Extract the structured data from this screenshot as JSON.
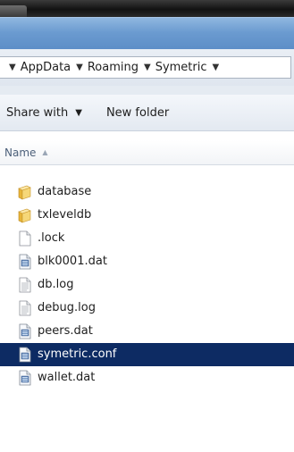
{
  "breadcrumb": {
    "items": [
      {
        "label": "AppData"
      },
      {
        "label": "Roaming"
      },
      {
        "label": "Symetric"
      },
      {
        "label": ""
      }
    ]
  },
  "toolbar": {
    "share_label": "Share with",
    "new_folder_label": "New folder"
  },
  "columns": {
    "name_label": "Name"
  },
  "files": [
    {
      "name": "database",
      "type": "folder-icon",
      "selected": false
    },
    {
      "name": "txleveldb",
      "type": "folder-icon",
      "selected": false
    },
    {
      "name": ".lock",
      "type": "blank-file-icon",
      "selected": false
    },
    {
      "name": "blk0001.dat",
      "type": "dat-file-icon",
      "selected": false
    },
    {
      "name": "db.log",
      "type": "text-file-icon",
      "selected": false
    },
    {
      "name": "debug.log",
      "type": "text-file-icon",
      "selected": false
    },
    {
      "name": "peers.dat",
      "type": "dat-file-icon",
      "selected": false
    },
    {
      "name": "symetric.conf",
      "type": "dat-file-icon",
      "selected": true
    },
    {
      "name": "wallet.dat",
      "type": "dat-file-icon",
      "selected": false
    }
  ],
  "colors": {
    "selection": "#0d2b63",
    "titlebar": "#6b9bd0",
    "folder": "#e8b53a"
  }
}
